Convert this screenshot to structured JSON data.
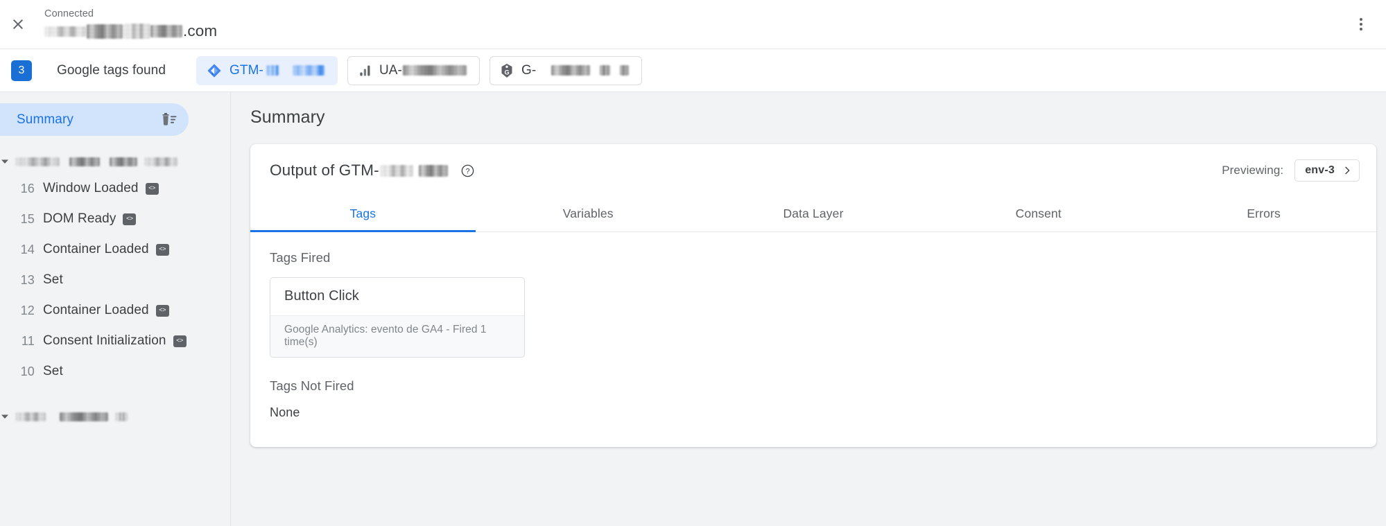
{
  "topbar": {
    "close_icon": "close-icon",
    "connected_label": "Connected",
    "domain_suffix": ".com",
    "overflow_icon": "more-vert-icon"
  },
  "tagsbar": {
    "count": "3",
    "title": "Google tags found",
    "chips": [
      {
        "icon": "gtm-diamond-icon",
        "prefix": "GTM-",
        "selected": true
      },
      {
        "icon": "analytics-bars-icon",
        "prefix": "UA-",
        "selected": false
      },
      {
        "icon": "google-tag-icon",
        "prefix": "G-",
        "selected": false
      }
    ]
  },
  "sidebar": {
    "summary_label": "Summary",
    "delete_icon": "trash-list-icon",
    "group_caret_icon": "caret-down-icon",
    "events": [
      {
        "num": "16",
        "label": "Window Loaded",
        "badge": "<>"
      },
      {
        "num": "15",
        "label": "DOM Ready",
        "badge": "<>"
      },
      {
        "num": "14",
        "label": "Container Loaded",
        "badge": "<>"
      },
      {
        "num": "13",
        "label": "Set",
        "badge": ""
      },
      {
        "num": "12",
        "label": "Container Loaded",
        "badge": "<>"
      },
      {
        "num": "11",
        "label": "Consent Initialization",
        "badge": "<>"
      },
      {
        "num": "10",
        "label": "Set",
        "badge": ""
      }
    ]
  },
  "main": {
    "page_title": "Summary",
    "card_title_prefix": "Output of GTM-",
    "help_icon": "help-circle-icon",
    "previewing_label": "Previewing:",
    "env_value": "env-3",
    "env_chevron_icon": "chevron-right-icon",
    "tabs": [
      {
        "label": "Tags",
        "active": true
      },
      {
        "label": "Variables",
        "active": false
      },
      {
        "label": "Data Layer",
        "active": false
      },
      {
        "label": "Consent",
        "active": false
      },
      {
        "label": "Errors",
        "active": false
      }
    ],
    "tags_fired_label": "Tags Fired",
    "fired_tag_name": "Button Click",
    "fired_tag_detail": "Google Analytics: evento de GA4 - Fired 1 time(s)",
    "tags_not_fired_label": "Tags Not Fired",
    "tags_not_fired_value": "None"
  },
  "colors": {
    "accent": "#1a73e8",
    "badge_blue": "#1a6fd4",
    "chip_selected_bg": "#e8f0fe",
    "sidebar_selected_bg": "#d2e3fc",
    "page_bg": "#f1f3f4"
  }
}
